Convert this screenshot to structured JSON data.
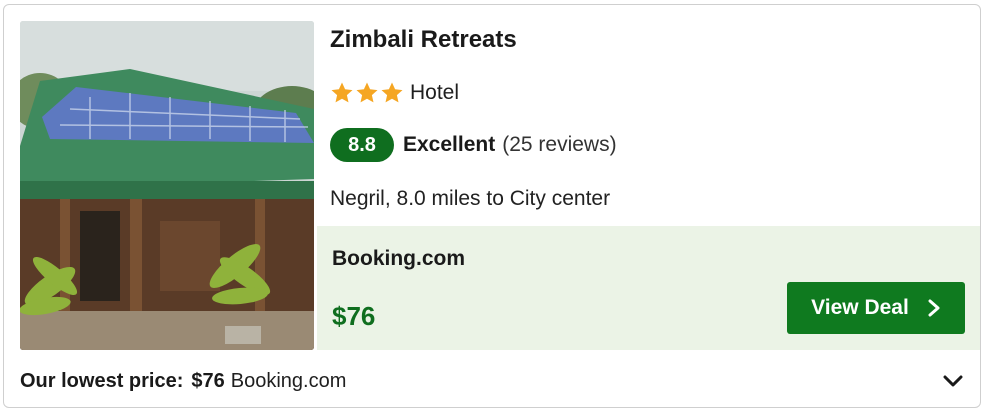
{
  "hotel": {
    "name": "Zimbali Retreats",
    "star_count": 3,
    "type": "Hotel",
    "score": "8.8",
    "score_label": "Excellent",
    "reviews": "(25 reviews)",
    "location": "Negril, 8.0 miles to City center"
  },
  "deal": {
    "provider": "Booking.com",
    "price": "$76",
    "button_label": "View Deal"
  },
  "footer": {
    "lowest_label": "Our lowest price:",
    "lowest_price": "$76",
    "lowest_provider": "Booking.com"
  },
  "colors": {
    "accent_green": "#0f7a1f",
    "score_green": "#0f6e1f",
    "star_orange": "#f5a623",
    "deal_bg": "#ebf3e6"
  },
  "icons": {
    "star": "star-icon",
    "button_chevron": "chevron-right-icon",
    "expand": "chevron-down-icon"
  }
}
